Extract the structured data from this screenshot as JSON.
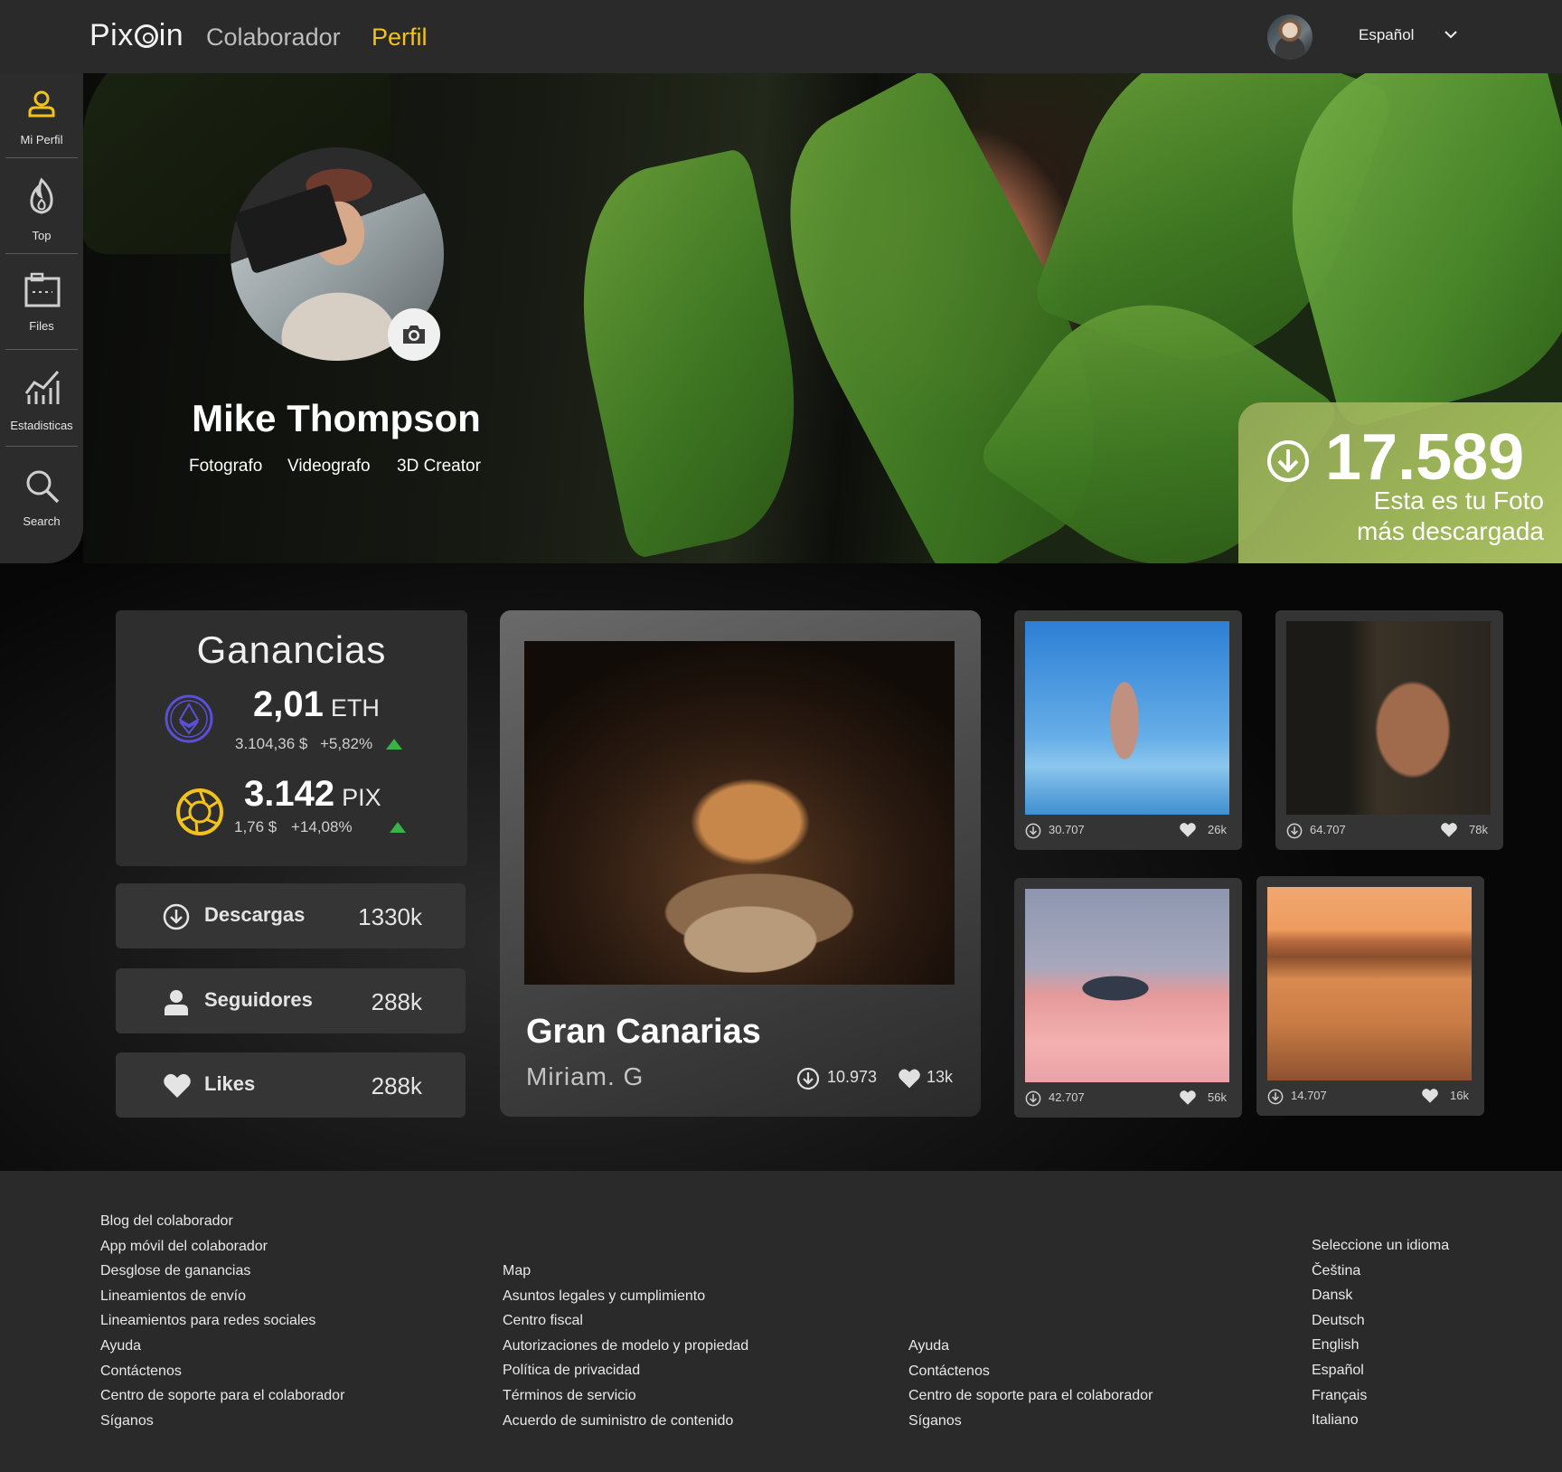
{
  "header": {
    "brand": "Pixcoin",
    "brand_pre": "Pix",
    "brand_post": "in",
    "section": "Colaborador",
    "page": "Perfil",
    "language": "Español"
  },
  "sidebar": {
    "items": [
      {
        "label": "Mi Perfil",
        "icon": "user-icon"
      },
      {
        "label": "Top",
        "icon": "flame-icon"
      },
      {
        "label": "Files",
        "icon": "files-icon"
      },
      {
        "label": "Estadisticas",
        "icon": "stats-icon"
      },
      {
        "label": "Search",
        "icon": "search-icon"
      }
    ]
  },
  "profile": {
    "name": "Mike Thompson",
    "roles": [
      "Fotografo",
      "Videografo",
      "3D Creator"
    ]
  },
  "top_download": {
    "count": "17.589",
    "line1": "Esta es tu Foto",
    "line2": "más descargada"
  },
  "earnings": {
    "title": "Ganancias",
    "eth": {
      "amount": "2,01",
      "unit": "ETH",
      "usd": "3.104,36 $",
      "change": "+5,82%"
    },
    "pix": {
      "amount": "3.142",
      "unit": "PIX",
      "usd": "1,76 $",
      "change": "+14,08%"
    }
  },
  "stats": [
    {
      "label": "Descargas",
      "value": "1330k",
      "icon": "download-icon"
    },
    {
      "label": "Seguidores",
      "value": "288k",
      "icon": "user-icon"
    },
    {
      "label": "Likes",
      "value": "288k",
      "icon": "heart-icon"
    }
  ],
  "featured": {
    "title": "Gran Canarias",
    "author": "Miriam. G",
    "downloads": "10.973",
    "likes": "13k"
  },
  "thumbnails": [
    {
      "downloads": "30.707",
      "likes": "26k"
    },
    {
      "downloads": "64.707",
      "likes": "78k"
    },
    {
      "downloads": "42.707",
      "likes": "56k"
    },
    {
      "downloads": "14.707",
      "likes": "16k"
    }
  ],
  "footer": {
    "col1": [
      "Blog del colaborador",
      "App móvil del colaborador",
      "Desglose de ganancias",
      "Lineamientos de envío",
      "Lineamientos para redes sociales",
      "Ayuda",
      "Contáctenos",
      "Centro de soporte para el colaborador",
      "Síganos"
    ],
    "col2": [
      "Map",
      "Asuntos legales y cumplimiento",
      "Centro fiscal",
      "Autorizaciones de modelo y propiedad",
      "Política de privacidad",
      "Términos de servicio",
      "Acuerdo de suministro de contenido"
    ],
    "col3": [
      "Ayuda",
      "Contáctenos",
      "Centro de soporte para el colaborador",
      "Síganos"
    ],
    "col4": [
      "Seleccione un idioma",
      "Čeština",
      "Dansk",
      "Deutsch",
      "English",
      "Español",
      "Français",
      "Italiano"
    ]
  },
  "colors": {
    "accent": "#f3c21b",
    "up": "#37b349",
    "eth": "#5b4fd6"
  }
}
